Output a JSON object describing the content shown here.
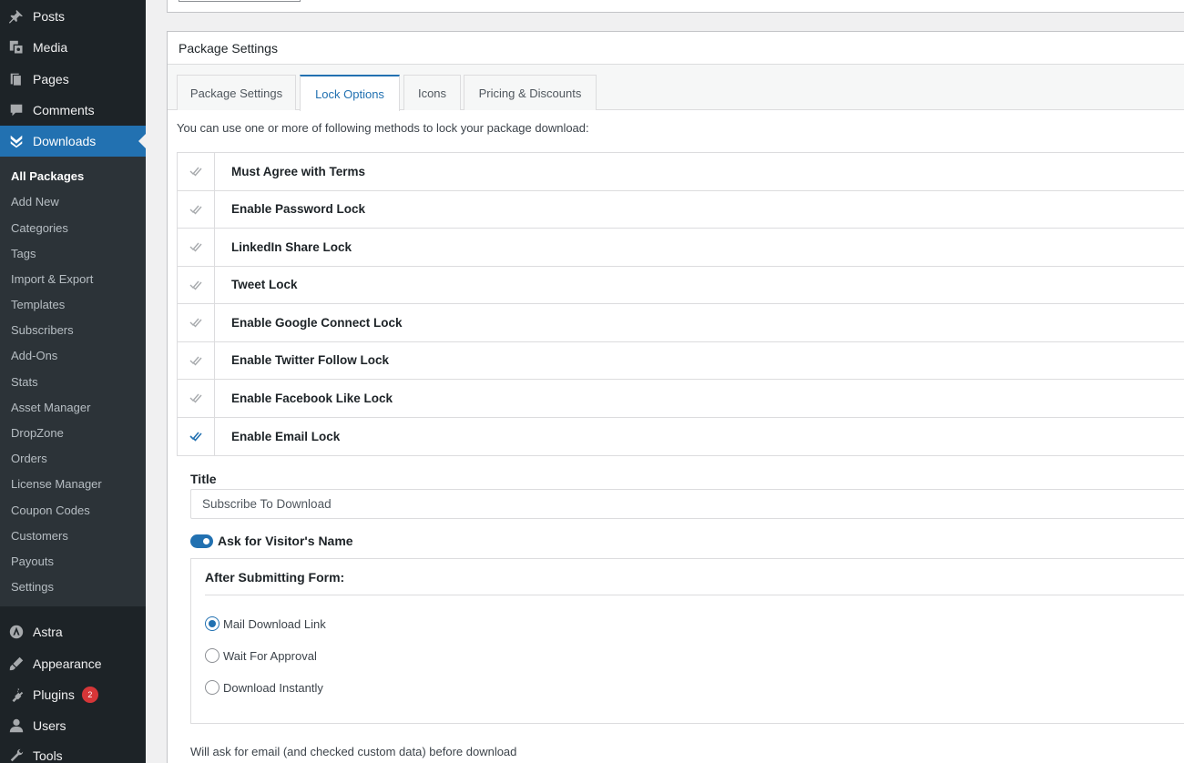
{
  "sidebar": {
    "top_items": [
      {
        "label": "Posts",
        "icon": "pin-icon"
      },
      {
        "label": "Media",
        "icon": "media-icon"
      },
      {
        "label": "Pages",
        "icon": "pages-icon"
      },
      {
        "label": "Comments",
        "icon": "comments-icon"
      },
      {
        "label": "Downloads",
        "icon": "downloads-icon"
      }
    ],
    "submenu": [
      "All Packages",
      "Add New",
      "Categories",
      "Tags",
      "Import & Export",
      "Templates",
      "Subscribers",
      "Add-Ons",
      "Stats",
      "Asset Manager",
      "DropZone",
      "Orders",
      "License Manager",
      "Coupon Codes",
      "Customers",
      "Payouts",
      "Settings"
    ],
    "bottom_items": [
      {
        "label": "Astra",
        "icon": "astra-icon"
      },
      {
        "label": "Appearance",
        "icon": "appearance-icon"
      },
      {
        "label": "Plugins",
        "icon": "plugins-icon",
        "badge": "2"
      },
      {
        "label": "Users",
        "icon": "users-icon"
      },
      {
        "label": "Tools",
        "icon": "tools-icon"
      }
    ]
  },
  "panel": {
    "title": "Package Settings",
    "tabs": [
      "Package Settings",
      "Lock Options",
      "Icons",
      "Pricing & Discounts"
    ],
    "active_tab": "Lock Options",
    "intro": "You can use one or more of following methods to lock your package download:",
    "locks": [
      {
        "label": "Must Agree with Terms",
        "enabled": false
      },
      {
        "label": "Enable Password Lock",
        "enabled": false
      },
      {
        "label": "LinkedIn Share Lock",
        "enabled": false
      },
      {
        "label": "Tweet Lock",
        "enabled": false
      },
      {
        "label": "Enable Google Connect Lock",
        "enabled": false
      },
      {
        "label": "Enable Twitter Follow Lock",
        "enabled": false
      },
      {
        "label": "Enable Facebook Like Lock",
        "enabled": false
      },
      {
        "label": "Enable Email Lock",
        "enabled": true
      }
    ],
    "email_lock": {
      "title_label": "Title",
      "title_value": "Subscribe To Download",
      "ask_name_label": "Ask for Visitor's Name",
      "ask_name_on": true,
      "after_title": "After Submitting Form:",
      "options": [
        "Mail Download Link",
        "Wait For Approval",
        "Download Instantly"
      ],
      "selected_option": "Mail Download Link",
      "note": "Will ask for email (and checked custom data) before download"
    }
  },
  "colors": {
    "accent": "#2271b1",
    "sidebar_bg": "#1d2327",
    "submenu_bg": "#2c3338",
    "badge": "#d63638"
  }
}
